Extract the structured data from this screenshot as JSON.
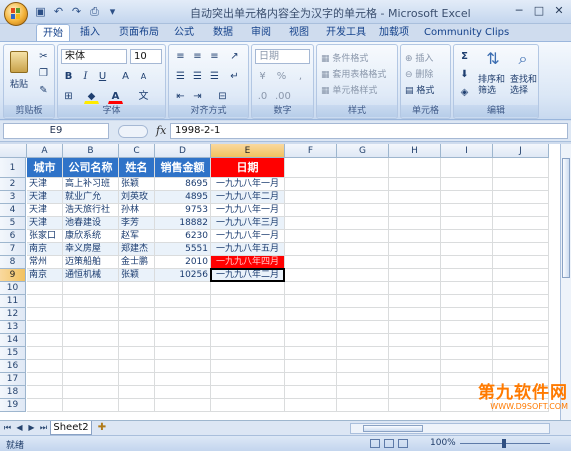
{
  "window": {
    "title": "自动突出单元格内容全为汉字的单元格 - Microsoft Excel",
    "buttons": {
      "minimize": "─",
      "maximize": "□",
      "close": "✕"
    }
  },
  "qat": [
    "save-icon",
    "undo-icon",
    "redo-icon",
    "print-icon",
    "customize-icon"
  ],
  "tabs": [
    "开始",
    "插入",
    "页面布局",
    "公式",
    "数据",
    "审阅",
    "视图",
    "开发工具",
    "加载项",
    "Community Clips"
  ],
  "active_tab": "开始",
  "ribbon": {
    "clipboard": {
      "label": "剪贴板",
      "paste": "粘贴"
    },
    "font": {
      "label": "字体",
      "name": "宋体",
      "size": "10",
      "bold": "B",
      "italic": "I",
      "underline": "U",
      "color_a": "A"
    },
    "alignment": {
      "label": "对齐方式"
    },
    "number": {
      "label": "数字",
      "format": "日期",
      "percent": "%"
    },
    "styles": {
      "label": "样式",
      "conditional": "条件格式",
      "table": "套用表格格式",
      "cell": "单元格样式"
    },
    "cells": {
      "label": "单元格",
      "insert": "插入",
      "delete": "删除",
      "format": "格式"
    },
    "editing": {
      "label": "编辑",
      "sum": "Σ",
      "sort": "排序和筛选",
      "find": "查找和选择"
    }
  },
  "formula_bar": {
    "name_box": "E9",
    "fx": "fx",
    "value": "1998-2-1"
  },
  "columns": [
    "A",
    "B",
    "C",
    "D",
    "E",
    "F",
    "G",
    "H",
    "I",
    "J"
  ],
  "rows": [
    "1",
    "2",
    "3",
    "4",
    "5",
    "6",
    "7",
    "8",
    "9",
    "10",
    "11",
    "12",
    "13",
    "14",
    "15",
    "16",
    "17",
    "18",
    "19"
  ],
  "table": {
    "headers": [
      "城市",
      "公司名称",
      "姓名",
      "销售金额",
      "日期"
    ],
    "rows": [
      [
        "天津",
        "高上补习班",
        "张颖",
        "8695",
        "一九九八年一月"
      ],
      [
        "天津",
        "就业广允",
        "刘英玫",
        "4895",
        "一九九八年二月"
      ],
      [
        "天津",
        "浩天旅行社",
        "孙林",
        "9753",
        "一九九八年一月"
      ],
      [
        "天津",
        "池春建设",
        "李芳",
        "18882",
        "一九九八年三月"
      ],
      [
        "张家口",
        "康欣系统",
        "赵军",
        "6230",
        "一九九八年一月"
      ],
      [
        "南京",
        "幸义房屋",
        "郑建杰",
        "5551",
        "一九九八年五月"
      ],
      [
        "常州",
        "迈策船舶",
        "金士鹏",
        "2010",
        "一九九八年四月"
      ],
      [
        "南京",
        "通恒机械",
        "张颖",
        "10256",
        "一九九八年二月"
      ]
    ]
  },
  "sheet_tabs": [
    "Sheet2"
  ],
  "status": {
    "text": "就绪",
    "zoom": "100%"
  },
  "watermark": {
    "line1": "第九软件网",
    "line2": "WWW.D9SOFT.COM"
  },
  "colors": {
    "header_blue": "#2f73c8",
    "highlight_red": "#ff0000",
    "row_alt": "#eaf2fa"
  }
}
